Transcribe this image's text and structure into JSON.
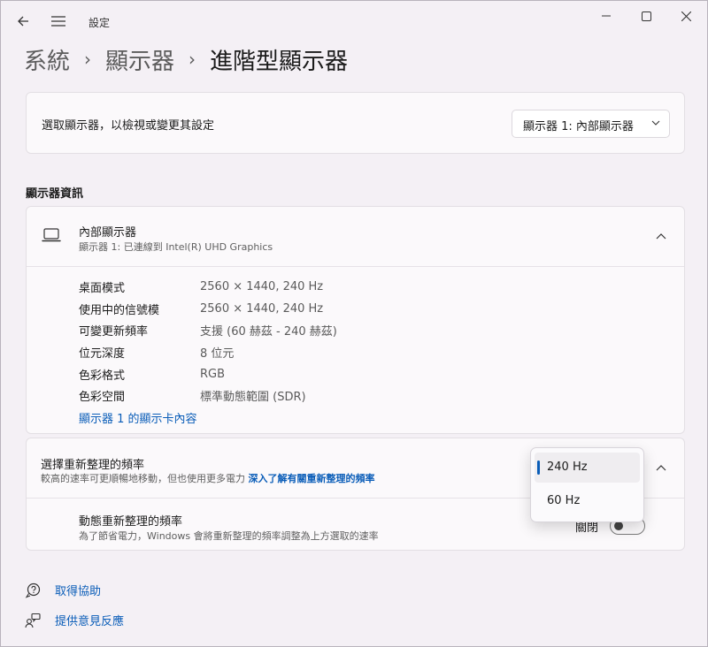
{
  "window": {
    "app_title": "設定"
  },
  "breadcrumb": {
    "items": [
      "系統",
      "顯示器"
    ],
    "separator": "›",
    "current": "進階型顯示器"
  },
  "display_select": {
    "label": "選取顯示器，以檢視或變更其設定",
    "value": "顯示器 1: 內部顯示器"
  },
  "display_info": {
    "section_title": "顯示器資訊",
    "name": "內部顯示器",
    "subtitle": "顯示器 1: 已連線到 Intel(R) UHD Graphics",
    "rows": [
      {
        "key": "桌面模式",
        "value": "2560 × 1440, 240 Hz"
      },
      {
        "key": "使用中的信號模",
        "value": "2560 × 1440, 240 Hz"
      },
      {
        "key": "可變更新頻率",
        "value": "支援 (60 赫茲 - 240 赫茲)"
      },
      {
        "key": "位元深度",
        "value": "8 位元"
      },
      {
        "key": "色彩格式",
        "value": "RGB"
      },
      {
        "key": "色彩空間",
        "value": "標準動態範圍 (SDR)"
      }
    ],
    "adapter_link": "顯示器 1 的顯示卡內容"
  },
  "refresh": {
    "title": "選擇重新整理的頻率",
    "description": "較高的速率可更順暢地移動，但也使用更多電力",
    "learn_more": "深入了解有關重新整理的頻率",
    "options": [
      "240 Hz",
      "60 Hz"
    ],
    "selected": "240 Hz",
    "dynamic_title": "動態重新整理的頻率",
    "dynamic_desc": "為了節省電力，Windows 會將重新整理的頻率調整為上方選取的速率",
    "dynamic_state": "關閉"
  },
  "footer": {
    "help": "取得協助",
    "feedback": "提供意見反應"
  },
  "colors": {
    "accent": "#0a5db8",
    "background": "#f4f0f5",
    "card": "#fbf9fb"
  }
}
